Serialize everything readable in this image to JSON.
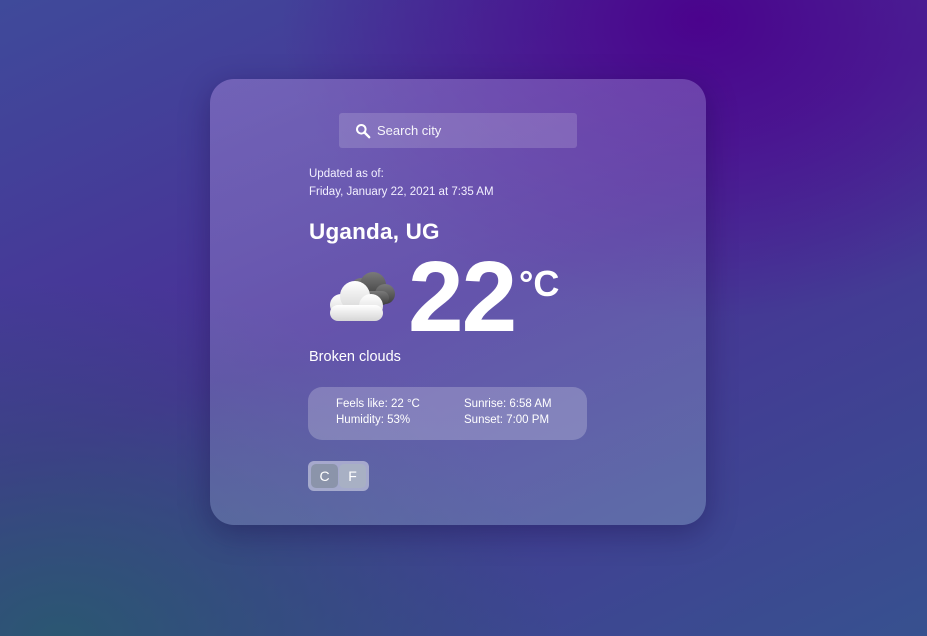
{
  "search": {
    "placeholder": "Search city",
    "icon": "search-icon"
  },
  "updated": {
    "label": "Updated as of:",
    "datetime": "Friday, January 22, 2021 at 7:35 AM"
  },
  "location": "Uganda, UG",
  "weather": {
    "icon": "broken-clouds-icon",
    "temperature": "22",
    "unit": "°C",
    "condition": "Broken clouds"
  },
  "details": {
    "feels_like": "Feels like: 22 °C",
    "humidity": "Humidity: 53%",
    "sunrise": "Sunrise: 6:58 AM",
    "sunset": "Sunset: 7:00 PM"
  },
  "units": {
    "celsius": "C",
    "fahrenheit": "F"
  }
}
